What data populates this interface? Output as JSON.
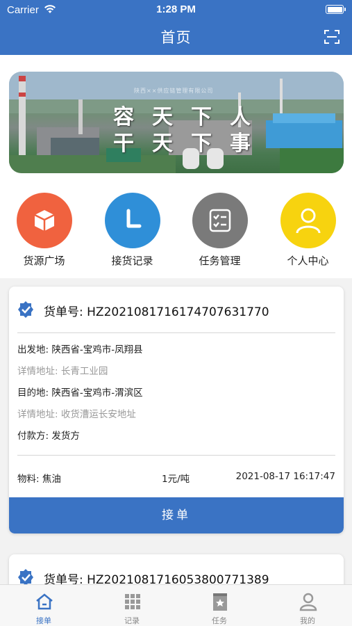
{
  "status_bar": {
    "carrier": "Carrier",
    "time": "1:28 PM"
  },
  "header": {
    "title": "首页"
  },
  "banner": {
    "company": "陕西××供应链管理有限公司",
    "line1": "容天下人",
    "line2": "干天下事"
  },
  "quick_actions": [
    {
      "label": "货源广场",
      "icon": "cube-icon",
      "color": "#f0623f"
    },
    {
      "label": "接货记录",
      "icon": "clock-icon",
      "color": "#2f8fd8"
    },
    {
      "label": "任务管理",
      "icon": "checklist-icon",
      "color": "#7a7a7a"
    },
    {
      "label": "个人中心",
      "icon": "user-icon",
      "color": "#f7d30f"
    }
  ],
  "orders": [
    {
      "order_label": "货单号:",
      "order_no": "HZ20210817161747076317​70",
      "origin_label": "出发地:",
      "origin": "陕西省-宝鸡市-凤翔县",
      "origin_detail_label": "详情地址:",
      "origin_detail": "长青工业园",
      "dest_label": "目的地:",
      "dest": "陕西省-宝鸡市-渭滨区",
      "dest_detail_label": "详情地址:",
      "dest_detail": "收货漕运长安地址",
      "payer_label": "付款方:",
      "payer": "发货方",
      "material": "物料:  焦油",
      "price": "1元/吨",
      "datetime": "2021-08-17 16:17:47",
      "accept_label": "接单"
    },
    {
      "order_label": "货单号:",
      "order_no": "HZ20210817160538007713​89"
    }
  ],
  "tabs": [
    {
      "label": "接单",
      "icon": "home-icon"
    },
    {
      "label": "记录",
      "icon": "grid-icon"
    },
    {
      "label": "任务",
      "icon": "bookmark-icon"
    },
    {
      "label": "我的",
      "icon": "profile-icon"
    }
  ],
  "colors": {
    "primary": "#3a73c4",
    "background": "#f2f2f2"
  }
}
